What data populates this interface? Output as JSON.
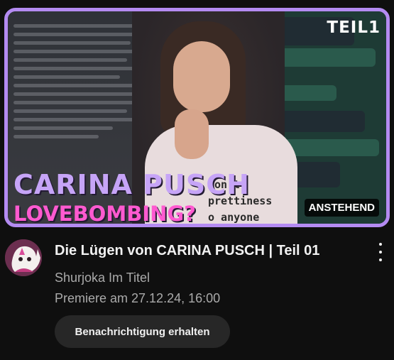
{
  "thumbnail": {
    "badge_top": "TEIL1",
    "title_main": "CARINA PUSCH",
    "title_sub": "LOVEBOMBING?",
    "shirt_lines": [
      "don't",
      "prettiness",
      "o anyone"
    ],
    "status_badge": "ANSTEHEND",
    "border_color": "#b48bf2"
  },
  "video": {
    "title": "Die Lügen von CARINA PUSCH | Teil 01",
    "channel": "Shurjoka Im Titel",
    "meta": "Premiere am 27.12.24, 16:00",
    "notify_label": "Benachrichtigung erhalten"
  },
  "icons": {
    "menu": "more-vertical-icon",
    "avatar": "channel-avatar"
  }
}
